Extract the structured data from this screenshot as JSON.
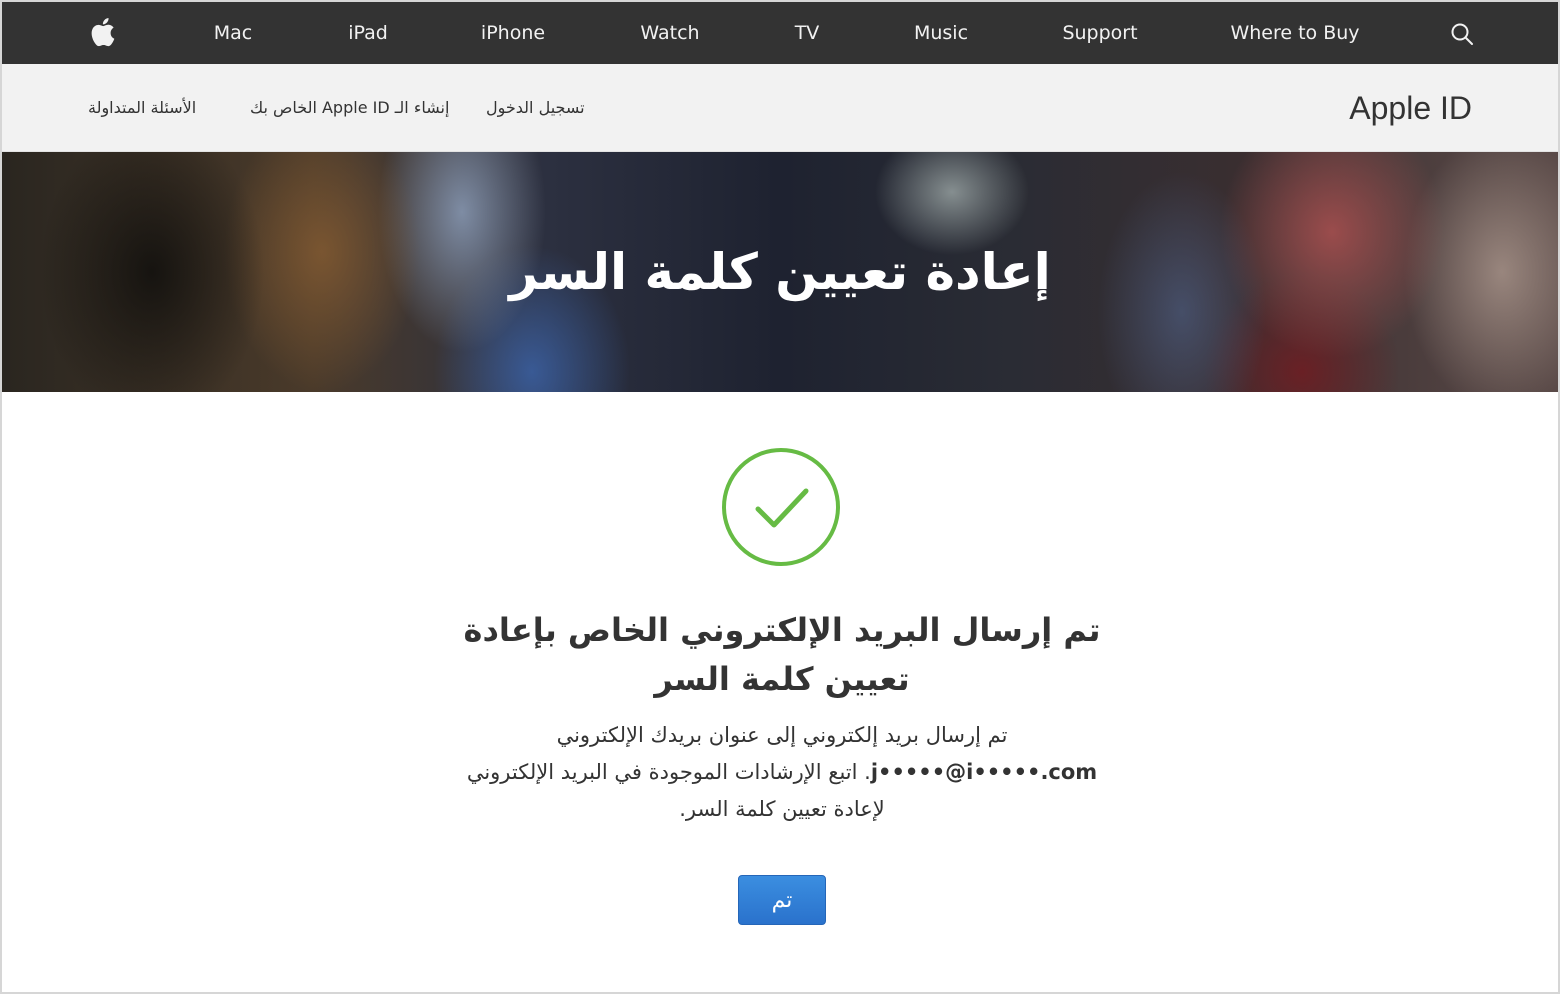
{
  "global_nav": {
    "items": [
      "Mac",
      "iPad",
      "iPhone",
      "Watch",
      "TV",
      "Music",
      "Support",
      "Where to Buy"
    ],
    "logo_icon": "apple-logo-icon",
    "search_icon": "search-icon"
  },
  "local_nav": {
    "title": "Apple ID",
    "links": [
      "تسجيل الدخول",
      "إنشاء الـ Apple ID الخاص بك",
      "الأسئلة المتداولة"
    ]
  },
  "hero": {
    "title": "إعادة تعيين كلمة السر"
  },
  "content": {
    "status_icon": "checkmark-circle-icon",
    "status_color": "#66bb44",
    "heading_line1": "تم إرسال البريد الإلكتروني الخاص بإعادة",
    "heading_line2": "تعيين كلمة السر",
    "body_line1": "تم إرسال بريد إلكتروني إلى عنوان بريدك الإلكتروني",
    "body_email": "j•••••@i•••••.com",
    "body_line2_rest": ". اتبع الإرشادات الموجودة في البريد الإلكتروني",
    "body_line3": "لإعادة تعيين كلمة السر.",
    "done_button": "تم",
    "button_color": "#2f7bd6"
  }
}
